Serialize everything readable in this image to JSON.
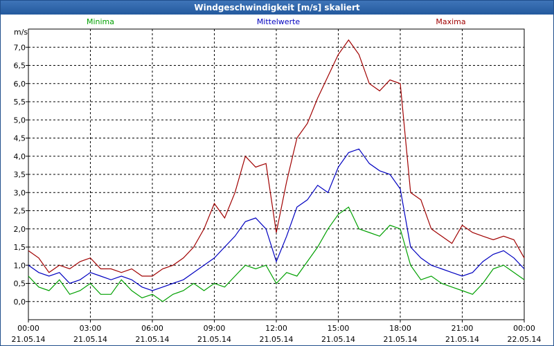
{
  "window": {
    "title": "Windgeschwindigkeit [m/s] skaliert"
  },
  "chart_data": {
    "type": "line",
    "title": "Windgeschwindigkeit [m/s] skaliert",
    "ylabel": "m/s",
    "xlabel": "",
    "ylim": [
      -0.5,
      7.5
    ],
    "yticks": [
      0,
      0.5,
      1,
      1.5,
      2,
      2.5,
      3,
      3.5,
      4,
      4.5,
      5,
      5.5,
      6,
      6.5,
      7
    ],
    "ytick_labels": [
      "0,0",
      "0,5",
      "1,0",
      "1,5",
      "2,0",
      "2,5",
      "3,0",
      "3,5",
      "4,0",
      "4,5",
      "5,0",
      "5,5",
      "6,0",
      "6,5",
      "7,0"
    ],
    "xlim": [
      0,
      24
    ],
    "xticks": [
      0,
      3,
      6,
      9,
      12,
      15,
      18,
      21,
      24
    ],
    "xtick_time_labels": [
      "00:00",
      "03:00",
      "06:00",
      "09:00",
      "12:00",
      "15:00",
      "18:00",
      "21:00",
      "00:00"
    ],
    "xtick_date_labels": [
      "21.05.14",
      "21.05.14",
      "21.05.14",
      "21.05.14",
      "21.05.14",
      "21.05.14",
      "21.05.14",
      "21.05.14",
      "22.05.14"
    ],
    "grid": true,
    "legend_position": "top",
    "series": [
      {
        "name": "Minima",
        "color": "#00a000",
        "x": [
          0,
          0.5,
          1,
          1.5,
          2,
          2.5,
          3,
          3.5,
          4,
          4.5,
          5,
          5.5,
          6,
          6.5,
          7,
          7.5,
          8,
          8.5,
          9,
          9.5,
          10,
          10.5,
          11,
          11.5,
          12,
          12.5,
          13,
          13.5,
          14,
          14.5,
          15,
          15.5,
          16,
          16.5,
          17,
          17.5,
          18,
          18.5,
          19,
          19.5,
          20,
          20.5,
          21,
          21.5,
          22,
          22.5,
          23,
          23.5,
          24
        ],
        "values": [
          0.7,
          0.4,
          0.3,
          0.6,
          0.2,
          0.3,
          0.5,
          0.2,
          0.2,
          0.6,
          0.3,
          0.1,
          0.2,
          0.0,
          0.2,
          0.3,
          0.5,
          0.3,
          0.5,
          0.4,
          0.7,
          1.0,
          0.9,
          1.0,
          0.5,
          0.8,
          0.7,
          1.1,
          1.5,
          2.0,
          2.4,
          2.6,
          2.0,
          1.9,
          1.8,
          2.1,
          2.0,
          1.0,
          0.6,
          0.7,
          0.5,
          0.4,
          0.3,
          0.2,
          0.5,
          0.9,
          1.0,
          0.8,
          0.6
        ]
      },
      {
        "name": "Mittelwerte",
        "color": "#0000c0",
        "x": [
          0,
          0.5,
          1,
          1.5,
          2,
          2.5,
          3,
          3.5,
          4,
          4.5,
          5,
          5.5,
          6,
          6.5,
          7,
          7.5,
          8,
          8.5,
          9,
          9.5,
          10,
          10.5,
          11,
          11.5,
          12,
          12.5,
          13,
          13.5,
          14,
          14.5,
          15,
          15.5,
          16,
          16.5,
          17,
          17.5,
          18,
          18.5,
          19,
          19.5,
          20,
          20.5,
          21,
          21.5,
          22,
          22.5,
          23,
          23.5,
          24
        ],
        "values": [
          1.0,
          0.8,
          0.7,
          0.8,
          0.5,
          0.6,
          0.8,
          0.7,
          0.6,
          0.7,
          0.6,
          0.4,
          0.3,
          0.4,
          0.5,
          0.6,
          0.8,
          1.0,
          1.2,
          1.5,
          1.8,
          2.2,
          2.3,
          2.0,
          1.1,
          1.8,
          2.6,
          2.8,
          3.2,
          3.0,
          3.7,
          4.1,
          4.2,
          3.8,
          3.6,
          3.5,
          3.1,
          1.5,
          1.2,
          1.0,
          0.9,
          0.8,
          0.7,
          0.8,
          1.1,
          1.3,
          1.4,
          1.2,
          0.9
        ]
      },
      {
        "name": "Maxima",
        "color": "#a00000",
        "x": [
          0,
          0.5,
          1,
          1.5,
          2,
          2.5,
          3,
          3.5,
          4,
          4.5,
          5,
          5.5,
          6,
          6.5,
          7,
          7.5,
          8,
          8.5,
          9,
          9.5,
          10,
          10.5,
          11,
          11.5,
          12,
          12.5,
          13,
          13.5,
          14,
          14.5,
          15,
          15.5,
          16,
          16.5,
          17,
          17.5,
          18,
          18.5,
          19,
          19.5,
          20,
          20.5,
          21,
          21.5,
          22,
          22.5,
          23,
          23.5,
          24
        ],
        "values": [
          1.4,
          1.2,
          0.8,
          1.0,
          0.9,
          1.1,
          1.2,
          0.9,
          0.9,
          0.8,
          0.9,
          0.7,
          0.7,
          0.9,
          1.0,
          1.2,
          1.5,
          2.0,
          2.7,
          2.3,
          3.0,
          4.0,
          3.7,
          3.8,
          1.9,
          3.3,
          4.5,
          4.9,
          5.6,
          6.2,
          6.8,
          7.2,
          6.8,
          6.0,
          5.8,
          6.1,
          6.0,
          3.0,
          2.8,
          2.0,
          1.8,
          1.6,
          2.1,
          1.9,
          1.8,
          1.7,
          1.8,
          1.7,
          1.2
        ]
      }
    ]
  }
}
